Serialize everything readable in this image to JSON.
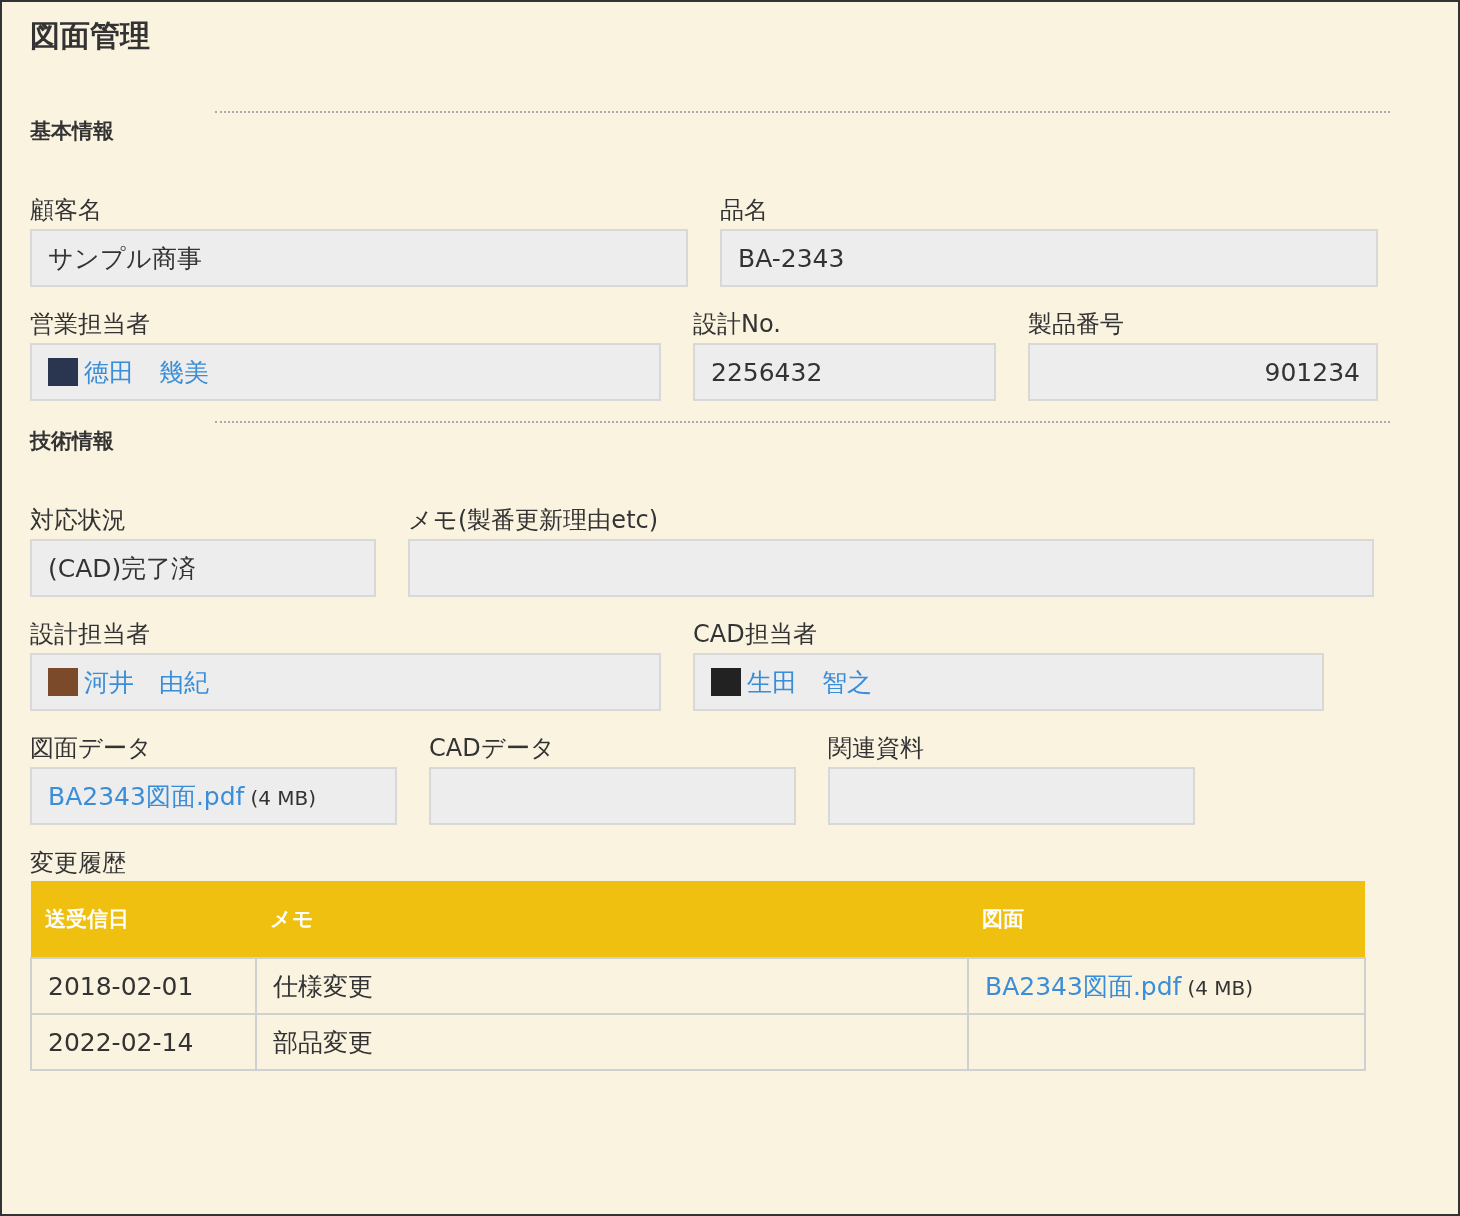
{
  "title": "図面管理",
  "sections": [
    {
      "heading": "基本情報",
      "rows": [
        [
          {
            "label": "顧客名",
            "kind": "text",
            "value": "サンプル商事"
          },
          {
            "label": "品名",
            "kind": "text",
            "value": "BA-2343"
          }
        ],
        [
          {
            "label": "営業担当者",
            "kind": "user",
            "value": "徳田　幾美"
          },
          {
            "label": "設計No.",
            "kind": "text",
            "value": "2256432"
          },
          {
            "label": "製品番号",
            "kind": "number",
            "value": "901234"
          }
        ]
      ]
    },
    {
      "heading": "技術情報",
      "rows": [
        [
          {
            "label": "対応状況",
            "kind": "text",
            "value": "(CAD)完了済"
          },
          {
            "label": "メモ(製番更新理由etc)",
            "kind": "text"
          }
        ],
        [
          {
            "label": "設計担当者",
            "kind": "user",
            "value": "河井　由紀"
          },
          {
            "label": "CAD担当者",
            "kind": "user",
            "value": "生田　智之"
          }
        ],
        [
          {
            "label": "図面データ",
            "kind": "file",
            "value": "BA2343図面.pdf",
            "size": "(4 MB)"
          },
          {
            "label": "CADデータ",
            "kind": "file"
          },
          {
            "label": "関連資料",
            "kind": "file"
          }
        ]
      ]
    }
  ],
  "history": {
    "label": "変更履歴",
    "columns": [
      "送受信日",
      "メモ",
      "図面"
    ],
    "rows": [
      {
        "date": "2018-02-01",
        "memo": "仕様変更",
        "file": "BA2343図面.pdf",
        "size": "(4 MB)"
      },
      {
        "date": "2022-02-14",
        "memo": "部品変更"
      }
    ]
  }
}
